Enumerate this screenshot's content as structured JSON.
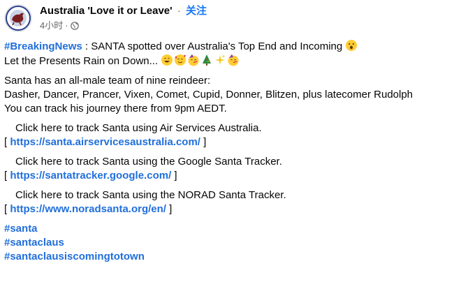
{
  "header": {
    "page_name": "Australia 'Love it or Leave'",
    "separator": "·",
    "follow_label": "关注",
    "timestamp": "4小时",
    "meta_separator": "·",
    "privacy_icon": "globe-icon"
  },
  "post": {
    "breaking_hashtag": "#BreakingNews",
    "breaking_text": " : SANTA spotted over Australia's Top End and Incoming ",
    "breaking_emoji": "astonished-face-emoji",
    "presents_text": "Let the Presents Rain on Down... ",
    "presents_emojis": [
      "grinning-face-emoji",
      "smiling-face-with-hearts-emoji",
      "partying-face-emoji",
      "christmas-tree-emoji",
      "sparkles-emoji",
      "partying-face-emoji"
    ],
    "reindeer_intro": "Santa has an all-male team of nine reindeer:",
    "reindeer_names": "Dasher, Dancer, Prancer, Vixen, Comet, Cupid, Donner, Blitzen, plus latecomer Rudolph",
    "track_time": "You can track his journey there from 9pm AEDT.",
    "trackers": [
      {
        "label": "Click here to track Santa using Air Services Australia.",
        "open": "[ ",
        "url": "https://santa.airservicesaustralia.com/",
        "close": " ]"
      },
      {
        "label": "Click here to track Santa using the Google Santa Tracker.",
        "open": "[ ",
        "url": "https://santatracker.google.com/",
        "close": " ]"
      },
      {
        "label": "Click here to track Santa using the NORAD Santa Tracker.",
        "open": "[ ",
        "url": "https://www.noradsanta.org/en/",
        "close": " ]"
      }
    ],
    "hashtags": [
      "#santa",
      "#santaclaus",
      "#santaclausiscomingtotown"
    ]
  },
  "colors": {
    "link": "#216fdb",
    "follow": "#1877f2",
    "meta": "#65676b",
    "text": "#050505"
  }
}
